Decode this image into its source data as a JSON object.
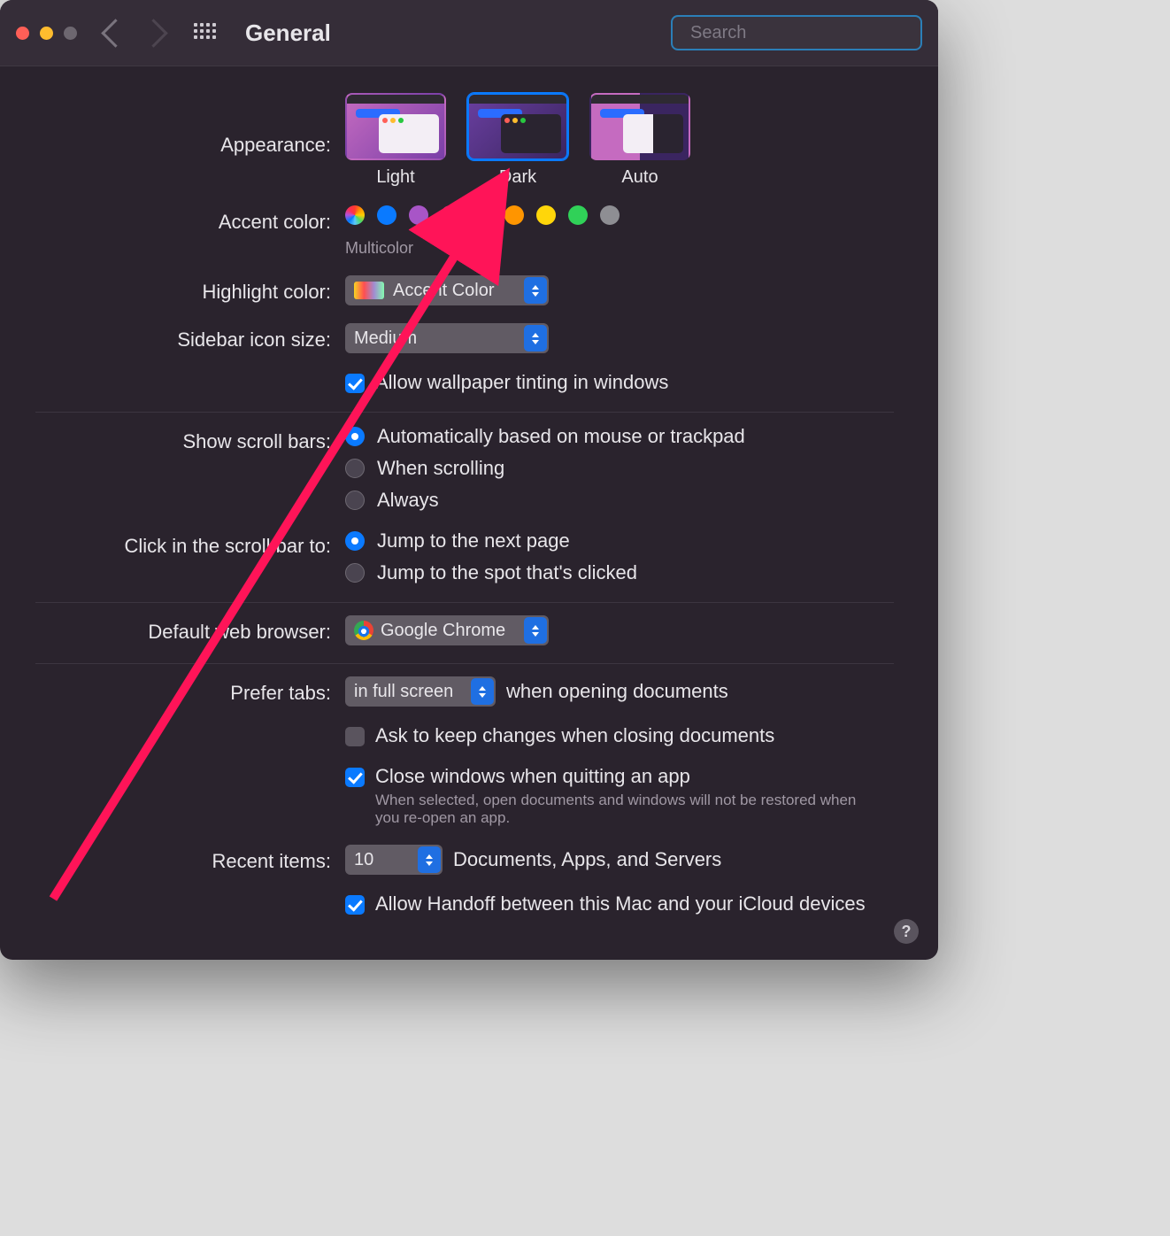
{
  "toolbar": {
    "title": "General",
    "search_placeholder": "Search"
  },
  "appearance": {
    "label": "Appearance:",
    "options": [
      "Light",
      "Dark",
      "Auto"
    ],
    "selected": "Dark"
  },
  "accent_color": {
    "label": "Accent color:",
    "selected_note": "Multicolor",
    "colors": [
      "multicolor",
      "#0a7aff",
      "#a855c7",
      "#ff3ea5",
      "#ff453a",
      "#ff9500",
      "#ffd60a",
      "#30d158",
      "#8e8e93"
    ]
  },
  "highlight_color": {
    "label": "Highlight color:",
    "value": "Accent Color"
  },
  "sidebar_icon_size": {
    "label": "Sidebar icon size:",
    "value": "Medium"
  },
  "wallpaper_tint": {
    "label": "Allow wallpaper tinting in windows",
    "checked": true
  },
  "scroll_bars": {
    "label": "Show scroll bars:",
    "options": [
      "Automatically based on mouse or trackpad",
      "When scrolling",
      "Always"
    ],
    "selected_index": 0
  },
  "click_scroll": {
    "label": "Click in the scroll bar to:",
    "options": [
      "Jump to the next page",
      "Jump to the spot that's clicked"
    ],
    "selected_index": 0
  },
  "default_browser": {
    "label": "Default web browser:",
    "value": "Google Chrome"
  },
  "prefer_tabs": {
    "label": "Prefer tabs:",
    "value": "in full screen",
    "suffix": "when opening documents"
  },
  "ask_keep_changes": {
    "label": "Ask to keep changes when closing documents",
    "checked": false
  },
  "close_windows": {
    "label": "Close windows when quitting an app",
    "sub": "When selected, open documents and windows will not be restored when you re-open an app.",
    "checked": true
  },
  "recent_items": {
    "label": "Recent items:",
    "value": "10",
    "suffix": "Documents, Apps, and Servers"
  },
  "handoff": {
    "label": "Allow Handoff between this Mac and your iCloud devices",
    "checked": true
  },
  "help": "?"
}
